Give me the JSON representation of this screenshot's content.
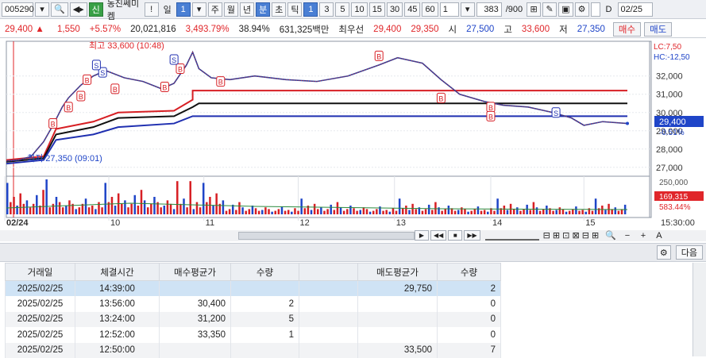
{
  "toolbar": {
    "code": "005290",
    "name_badge": "신",
    "name": "동진쎄미켐",
    "excl": "!",
    "period_sel": "일",
    "period_num": "1",
    "periods": [
      "주",
      "월",
      "년",
      "분",
      "초",
      "틱"
    ],
    "minutes": [
      "1",
      "3",
      "5",
      "10",
      "15",
      "30",
      "45",
      "60"
    ],
    "interval": "1",
    "count": "383",
    "count_total": "/900",
    "date": "02/25"
  },
  "quote": {
    "price": "29,400",
    "change": "1,550",
    "change_pct": "+5.57%",
    "volume": "20,021,816",
    "vol_ratio": "3,493.79%",
    "turnover": "38.94%",
    "amount": "631,325백만",
    "pref_label": "최우선",
    "ask": "29,400",
    "bid": "29,350",
    "open_label": "시",
    "open": "27,500",
    "high_label": "고",
    "high": "33,600",
    "low_label": "저",
    "low": "27,350",
    "buy_btn": "매수",
    "sell_btn": "매도"
  },
  "chart_data": {
    "type": "line",
    "title": "",
    "x_labels": [
      "02/24",
      "10",
      "11",
      "12",
      "13",
      "14",
      "15",
      "15:30:00"
    ],
    "y_ticks": [
      "32,000",
      "31,000",
      "30,000",
      "29,000",
      "28,000",
      "27,000"
    ],
    "ylim": [
      26600,
      33900
    ],
    "price_series": [
      {
        "t": 0,
        "v": 27350
      },
      {
        "t": 0.02,
        "v": 27400
      },
      {
        "t": 0.04,
        "v": 27600
      },
      {
        "t": 0.06,
        "v": 28400
      },
      {
        "t": 0.075,
        "v": 29300
      },
      {
        "t": 0.09,
        "v": 30300
      },
      {
        "t": 0.1,
        "v": 30800
      },
      {
        "t": 0.12,
        "v": 31500
      },
      {
        "t": 0.14,
        "v": 32000
      },
      {
        "t": 0.16,
        "v": 32300
      },
      {
        "t": 0.19,
        "v": 31900
      },
      {
        "t": 0.22,
        "v": 31700
      },
      {
        "t": 0.25,
        "v": 31300
      },
      {
        "t": 0.27,
        "v": 31600
      },
      {
        "t": 0.29,
        "v": 32600
      },
      {
        "t": 0.3,
        "v": 33300
      },
      {
        "t": 0.31,
        "v": 32400
      },
      {
        "t": 0.33,
        "v": 31900
      },
      {
        "t": 0.36,
        "v": 31800
      },
      {
        "t": 0.4,
        "v": 32000
      },
      {
        "t": 0.45,
        "v": 31800
      },
      {
        "t": 0.5,
        "v": 31700
      },
      {
        "t": 0.55,
        "v": 32000
      },
      {
        "t": 0.6,
        "v": 32600
      },
      {
        "t": 0.63,
        "v": 33000
      },
      {
        "t": 0.67,
        "v": 32700
      },
      {
        "t": 0.7,
        "v": 31800
      },
      {
        "t": 0.73,
        "v": 31000
      },
      {
        "t": 0.77,
        "v": 30600
      },
      {
        "t": 0.8,
        "v": 30400
      },
      {
        "t": 0.84,
        "v": 30300
      },
      {
        "t": 0.88,
        "v": 30000
      },
      {
        "t": 0.91,
        "v": 29700
      },
      {
        "t": 0.93,
        "v": 29300
      },
      {
        "t": 0.96,
        "v": 29500
      },
      {
        "t": 1.0,
        "v": 29400
      }
    ],
    "band_red": [
      {
        "t": 0,
        "v": 27400
      },
      {
        "t": 0.06,
        "v": 27600
      },
      {
        "t": 0.08,
        "v": 29100
      },
      {
        "t": 0.14,
        "v": 29500
      },
      {
        "t": 0.18,
        "v": 30000
      },
      {
        "t": 0.27,
        "v": 30100
      },
      {
        "t": 0.3,
        "v": 30700
      },
      {
        "t": 0.3,
        "v": 31200
      },
      {
        "t": 1.0,
        "v": 31200
      }
    ],
    "band_black": [
      {
        "t": 0,
        "v": 27300
      },
      {
        "t": 0.06,
        "v": 27500
      },
      {
        "t": 0.08,
        "v": 28800
      },
      {
        "t": 0.14,
        "v": 29200
      },
      {
        "t": 0.18,
        "v": 29700
      },
      {
        "t": 0.27,
        "v": 29800
      },
      {
        "t": 0.3,
        "v": 30300
      },
      {
        "t": 0.31,
        "v": 30500
      },
      {
        "t": 1.0,
        "v": 30500
      }
    ],
    "band_blue": [
      {
        "t": 0,
        "v": 27200
      },
      {
        "t": 0.06,
        "v": 27400
      },
      {
        "t": 0.08,
        "v": 28500
      },
      {
        "t": 0.14,
        "v": 28800
      },
      {
        "t": 0.18,
        "v": 29200
      },
      {
        "t": 0.27,
        "v": 29400
      },
      {
        "t": 0.3,
        "v": 29800
      },
      {
        "t": 1.0,
        "v": 29800
      }
    ],
    "markers": [
      {
        "t": 0.075,
        "v": 29400,
        "label": "B"
      },
      {
        "t": 0.1,
        "v": 30300,
        "label": "B"
      },
      {
        "t": 0.12,
        "v": 30900,
        "label": "B"
      },
      {
        "t": 0.13,
        "v": 31800,
        "label": "B"
      },
      {
        "t": 0.155,
        "v": 32200,
        "label": "S"
      },
      {
        "t": 0.145,
        "v": 32600,
        "label": "S"
      },
      {
        "t": 0.175,
        "v": 31300,
        "label": "B"
      },
      {
        "t": 0.255,
        "v": 31400,
        "label": "B"
      },
      {
        "t": 0.28,
        "v": 32400,
        "label": "B"
      },
      {
        "t": 0.27,
        "v": 32900,
        "label": "S"
      },
      {
        "t": 0.345,
        "v": 31700,
        "label": "B"
      },
      {
        "t": 0.6,
        "v": 33100,
        "label": "B"
      },
      {
        "t": 0.7,
        "v": 30800,
        "label": "B"
      },
      {
        "t": 0.78,
        "v": 30300,
        "label": "B"
      },
      {
        "t": 0.78,
        "v": 29800,
        "label": "B"
      },
      {
        "t": 0.885,
        "v": 30000,
        "label": "S"
      }
    ],
    "annotations": {
      "high": "최고 33,600 (10:48)",
      "low": "최저 27,350 (09:01)",
      "lc": "LC:7,50",
      "hc": "HC:-12,50",
      "last_price": "29,400",
      "last_pct": "-0.51%"
    },
    "volume_ticks": [
      "250,000"
    ],
    "volume_last": "169,315",
    "volume_pct": "583.44%"
  },
  "table": {
    "headers": [
      "거래일",
      "체결시간",
      "매수평균가",
      "수량",
      "",
      "매도평균가",
      "수량"
    ],
    "rows": [
      [
        "2025/02/25",
        "14:39:00",
        "",
        "",
        "",
        "29,750",
        "2"
      ],
      [
        "2025/02/25",
        "13:56:00",
        "30,400",
        "2",
        "",
        "",
        "0"
      ],
      [
        "2025/02/25",
        "13:24:00",
        "31,200",
        "5",
        "",
        "",
        "0"
      ],
      [
        "2025/02/25",
        "12:52:00",
        "33,350",
        "1",
        "",
        "",
        "0"
      ],
      [
        "2025/02/25",
        "12:50:00",
        "",
        "",
        "",
        "33,500",
        "7"
      ]
    ]
  },
  "bottom": {
    "next_btn": "다음"
  }
}
